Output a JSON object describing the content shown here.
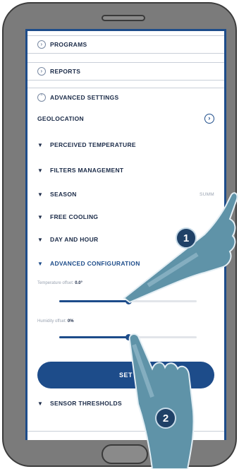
{
  "menu": {
    "programs": "PROGRAMS",
    "reports": "REPORTS",
    "advanced_settings": "ADVANCED SETTINGS"
  },
  "settings": {
    "geolocation": "GEOLOCATION",
    "perceived_temperature": "PERCEIVED TEMPERATURE",
    "filters_management": "FILTERS MANAGEMENT",
    "season": "SEASON",
    "season_value": "SUMM",
    "free_cooling": "FREE COOLING",
    "day_and_hour": "DAY AND HOUR",
    "advanced_configuration": "ADVANCED CONFIGURATION",
    "sensor_thresholds": "SENSOR THRESHOLDS"
  },
  "sliders": {
    "temperature_label": "Temperature offset:",
    "temperature_value": "0.0°",
    "temperature_level_pct": 50,
    "humidity_label": "Humidity offset:",
    "humidity_value": "0%",
    "humidity_level_pct": 50
  },
  "set_button": "SET",
  "callouts": {
    "one": "1",
    "two": "2"
  },
  "colors": {
    "accent": "#1d4c8a",
    "phone_body": "#7b7b7b",
    "hand": "#5f93a8"
  },
  "icons": {
    "expand": "chevron-down-icon",
    "circle": "circle-chevron-icon",
    "forward": "chevron-right-circle-icon"
  }
}
